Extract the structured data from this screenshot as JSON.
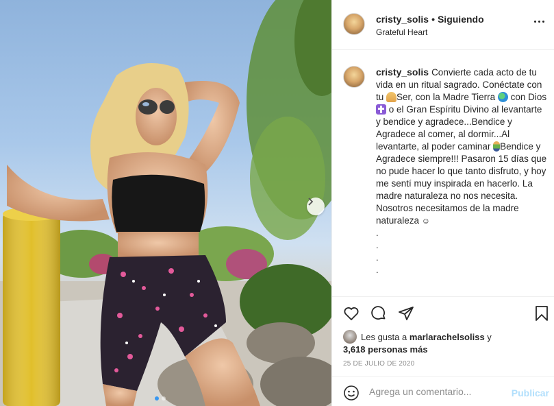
{
  "post": {
    "author": "cristy_solis",
    "separator": "•",
    "follow_state": "Siguiendo",
    "location": "Grateful Heart",
    "caption": {
      "username": "cristy_solis",
      "part1": "Convierte cada acto de tu vida en un ritual sagrado. Conéctate con tu ",
      "part2": "Ser, con la Madre Tierra ",
      "part3": " con Dios ",
      "part4": " o el Gran Espíritu Divino al levantarte y bendice y agradece...Bendice y Agradece al comer, al dormir...Al levantarte, al poder caminar ",
      "part5": "Bendice y Agradece siempre!!! Pasaron 15 días que no pude hacer lo que tanto disfruto, y hoy me sentí muy inspirada en hacerlo. La madre naturaleza no nos necesita. Nosotros necesitamos de la madre naturaleza ",
      "smile": "☺",
      "dots": [
        ".",
        ".",
        ".",
        "."
      ]
    },
    "emojis": [
      "praying-hands",
      "globe",
      "cross",
      "person-walking",
      "smiling-face"
    ],
    "likes": {
      "prefix": "Les gusta a ",
      "user": "marlarachelsoliss",
      "connector": " y",
      "count": "3,618 personas más"
    },
    "date": "25 DE JULIO DE 2020",
    "comment": {
      "placeholder": "Agrega un comentario...",
      "publish_label": "Publicar"
    },
    "carousel": {
      "slides": 2,
      "active": 1
    }
  },
  "colors": {
    "text": "#262626",
    "muted": "#8e8e8e",
    "border": "#efefef",
    "publish_disabled": "#b2dffc",
    "carousel_active": "#3897f0"
  },
  "icons": [
    "heart-icon",
    "comment-icon",
    "share-icon",
    "bookmark-icon",
    "emoji-icon",
    "more-options-icon",
    "chevron-right-icon"
  ]
}
